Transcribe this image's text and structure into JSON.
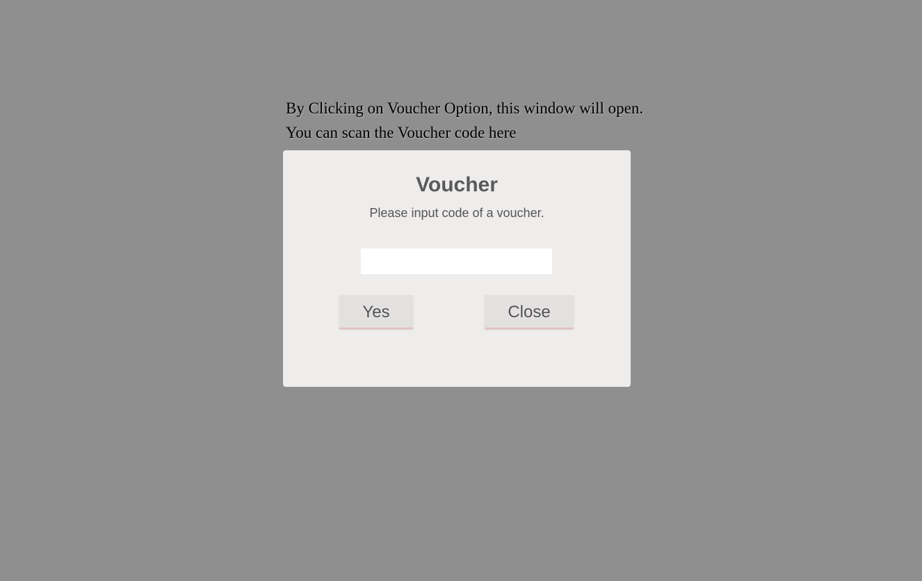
{
  "instructions": {
    "line1": "By Clicking on Voucher Option, this window will open.",
    "line2": "You can scan the Voucher code here"
  },
  "dialog": {
    "title": "Voucher",
    "message": "Please input code of a voucher.",
    "input": {
      "value": "",
      "placeholder": ""
    },
    "yes_label": "Yes",
    "close_label": "Close"
  },
  "colors": {
    "overlay_background": "#8f8f8f",
    "dialog_background": "#efecec",
    "button_background": "#e3e0e0",
    "button_accent_underline": "#f4a9a3",
    "title_text": "#5a5a5a"
  }
}
